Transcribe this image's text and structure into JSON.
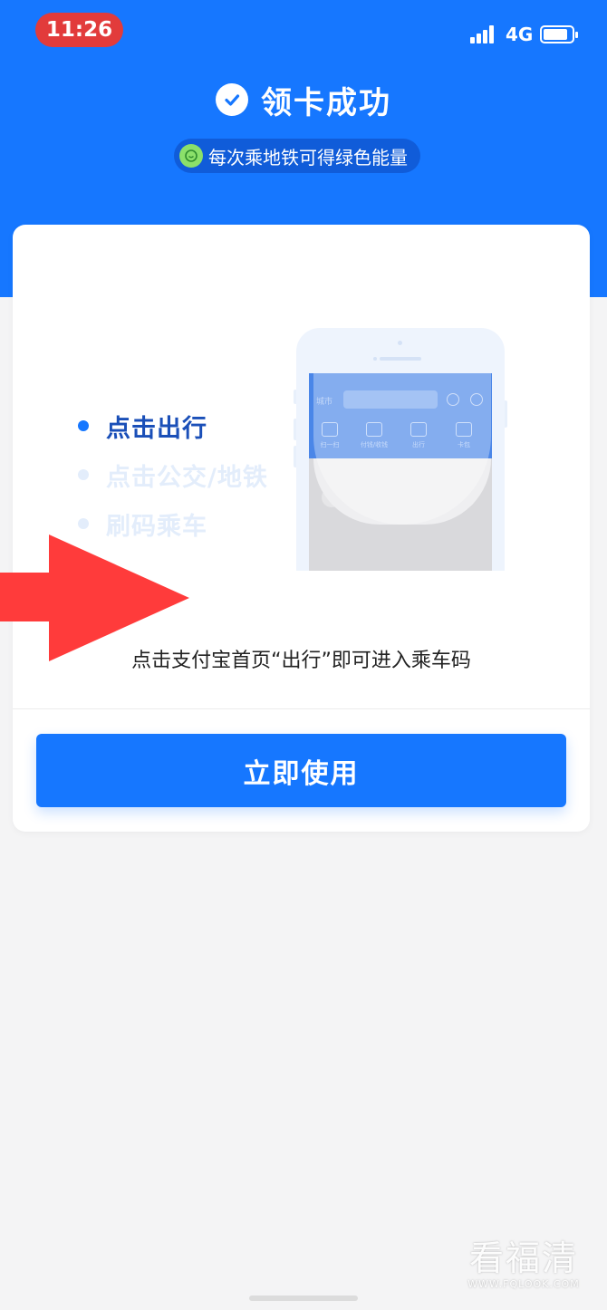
{
  "status_bar": {
    "time": "11:26",
    "network": "4G",
    "time_pill_color": "#e23b3b"
  },
  "header": {
    "title": "领卡成功",
    "energy_badge": "每次乘地铁可得绿色能量",
    "background_color": "#1677ff"
  },
  "guide": {
    "steps": [
      {
        "label": "点击出行",
        "state": "active"
      },
      {
        "label": "点击公交/地铁",
        "state": "faded"
      },
      {
        "label": "刷码乘车",
        "state": "faded"
      }
    ],
    "phone_screen": {
      "city": "城市",
      "grid_items": [
        "扫一扫",
        "付钱/收钱",
        "出行",
        "卡包"
      ]
    },
    "hint": "点击支付宝首页“出行”即可进入乘车码"
  },
  "actions": {
    "use_now_label": "立即使用"
  },
  "watermark": {
    "main": "看福清",
    "sub": "WWW.FQLOOK.COM"
  },
  "icons": [
    "check-circle-icon",
    "green-energy-icon",
    "signal-icon",
    "battery-icon",
    "red-arrow-icon"
  ]
}
